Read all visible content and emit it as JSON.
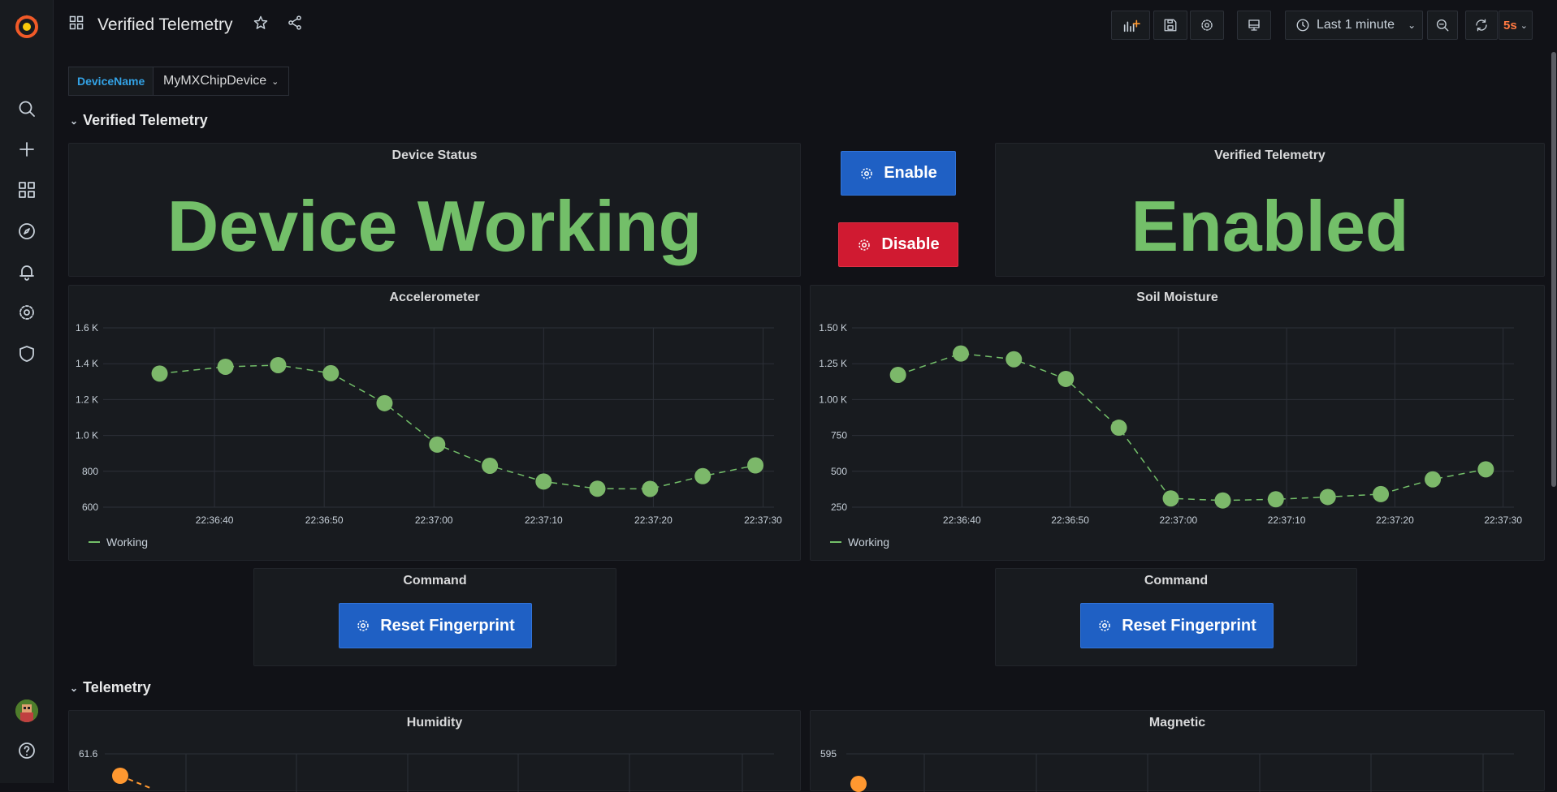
{
  "app": {
    "dashboard_title": "Verified Telemetry",
    "time_picker_label": "Last 1 minute",
    "refresh_interval": "5s",
    "accent_color": "#ff7941"
  },
  "variables": {
    "label": "DeviceName",
    "value": "MyMXChipDevice"
  },
  "rows": [
    {
      "title": "Verified Telemetry"
    },
    {
      "title": "Telemetry"
    }
  ],
  "panels": {
    "device_status": {
      "title": "Device Status",
      "value": "Device Working",
      "color": "#73bf69"
    },
    "verified_telemetry": {
      "title": "Verified Telemetry",
      "value": "Enabled",
      "color": "#73bf69"
    },
    "enable_button": {
      "label": "Enable"
    },
    "disable_button": {
      "label": "Disable"
    },
    "command_left": {
      "title": "Command",
      "button_label": "Reset Fingerprint"
    },
    "command_right": {
      "title": "Command",
      "button_label": "Reset Fingerprint"
    },
    "humidity": {
      "title": "Humidity",
      "first_tick": "61.6"
    },
    "magnetic": {
      "title": "Magnetic",
      "first_tick": "595"
    }
  },
  "chart_data": [
    {
      "type": "line",
      "title": "Accelerometer",
      "x_ticks": [
        "22:36:40",
        "22:36:50",
        "22:37:00",
        "22:37:10",
        "22:37:20",
        "22:37:30"
      ],
      "y_ticks": [
        "1.6 K",
        "1.4 K",
        "1.2 K",
        "1.0 K",
        "800",
        "600"
      ],
      "ylim": [
        600,
        1600
      ],
      "x": [
        "22:36:35",
        "22:36:41",
        "22:36:45",
        "22:36:50",
        "22:36:55",
        "22:36:59",
        "22:37:04",
        "22:37:09",
        "22:37:14",
        "22:37:19",
        "22:37:24",
        "22:37:29"
      ],
      "x_seconds": [
        35,
        41,
        45.8,
        50.6,
        55.5,
        60.3,
        65.1,
        70,
        74.9,
        79.7,
        84.5,
        89.3
      ],
      "series": [
        {
          "name": "Working",
          "values": [
            1345,
            1383,
            1392,
            1347,
            1180,
            949,
            831,
            743,
            703,
            702,
            773,
            833
          ],
          "color": "#73bf69"
        }
      ],
      "legend_position": "bottom-left",
      "grid": true
    },
    {
      "type": "line",
      "title": "Soil Moisture",
      "x_ticks": [
        "22:36:40",
        "22:36:50",
        "22:37:00",
        "22:37:10",
        "22:37:20",
        "22:37:30"
      ],
      "y_ticks": [
        "1.50 K",
        "1.25 K",
        "1.00 K",
        "750",
        "500",
        "250"
      ],
      "ylim": [
        250,
        1500
      ],
      "x": [
        "22:36:34",
        "22:36:40",
        "22:36:45",
        "22:36:49",
        "22:36:54",
        "22:36:59",
        "22:37:04",
        "22:37:09",
        "22:37:14",
        "22:37:19",
        "22:37:24",
        "22:37:29"
      ],
      "x_seconds": [
        34.1,
        39.9,
        44.8,
        49.6,
        54.5,
        59.3,
        64.1,
        69,
        73.8,
        78.7,
        83.5,
        88.4
      ],
      "series": [
        {
          "name": "Working",
          "values": [
            1172,
            1321,
            1281,
            1144,
            804,
            311,
            297,
            305,
            321,
            341,
            444,
            514
          ],
          "color": "#73bf69"
        }
      ],
      "legend_position": "bottom-left",
      "grid": true
    }
  ]
}
